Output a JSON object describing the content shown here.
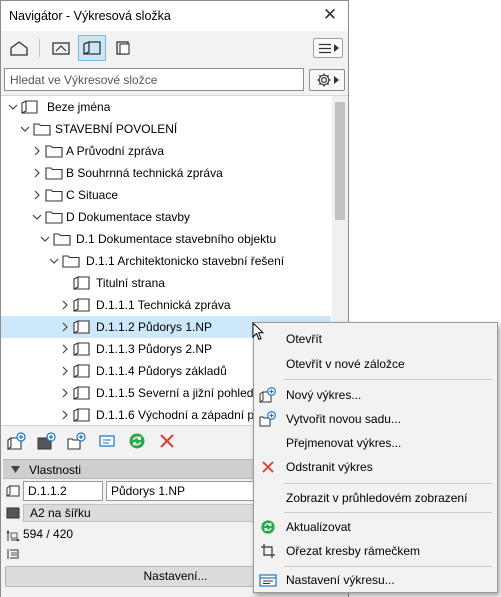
{
  "window": {
    "title": "Navigátor - Výkresová složka"
  },
  "search": {
    "placeholder": "Hledat ve Výkresové složce"
  },
  "toolbar": {
    "buttons": [
      {
        "icon": "project-map-icon"
      },
      {
        "icon": "view-map-icon"
      },
      {
        "icon": "layout-book-icon",
        "active": true
      },
      {
        "icon": "publisher-sets-icon"
      }
    ]
  },
  "tree": {
    "items": [
      {
        "label": "Beze jména",
        "expanded": true
      },
      {
        "label": "STAVEBNÍ POVOLENÍ",
        "expanded": true
      },
      {
        "label": "A Průvodní zpráva",
        "expanded": false
      },
      {
        "label": "B Souhrnná technická zpráva",
        "expanded": false
      },
      {
        "label": "C Situace",
        "expanded": false
      },
      {
        "label": "D Dokumentace stavby",
        "expanded": true
      },
      {
        "label": "D.1 Dokumentace stavebního objektu",
        "expanded": true
      },
      {
        "label": "D.1.1 Architektonicko stavební řešení",
        "expanded": true
      },
      {
        "label": "Titulní strana"
      },
      {
        "label": "D.1.1.1 Technická zpráva",
        "expanded": false
      },
      {
        "label": "D.1.1.2 Půdorys 1.NP",
        "expanded": false,
        "selected": true
      },
      {
        "label": "D.1.1.3 Půdorys 2.NP",
        "expanded": false
      },
      {
        "label": "D.1.1.4 Půdorys základů",
        "expanded": false
      },
      {
        "label": "D.1.1.5 Severní a jižní pohled",
        "expanded": false
      },
      {
        "label": "D.1.1.6 Východní a západní pohled",
        "expanded": false
      }
    ]
  },
  "properties": {
    "header": "Vlastnosti",
    "id_value": "D.1.1.2",
    "name_value": "Půdorys 1.NP",
    "master_layout": "A2 na šířku",
    "size": "594 / 420",
    "settings_button": "Nastavení..."
  },
  "context_menu": {
    "items": [
      {
        "label": "Otevřít",
        "icon": ""
      },
      {
        "label": "Otevřít v nové záložce",
        "icon": ""
      },
      {
        "label": "Nový výkres...",
        "icon": "new-layout-icon"
      },
      {
        "label": "Vytvořit novou sadu...",
        "icon": "new-subset-icon"
      },
      {
        "label": "Přejmenovat výkres...",
        "icon": ""
      },
      {
        "label": "Odstranit výkres",
        "icon": "delete-icon"
      },
      {
        "label": "Zobrazit v průhledovém zobrazení",
        "icon": ""
      },
      {
        "label": "Aktualizovat",
        "icon": "update-icon"
      },
      {
        "label": "Ořezat kresby rámečkem",
        "icon": "crop-icon"
      },
      {
        "label": "Nastavení výkresu...",
        "icon": "layout-settings-icon"
      }
    ]
  },
  "colors": {
    "selection": "#cde8fa",
    "accent_blue": "#1a73c8",
    "delete_red": "#e03a2f",
    "update_green": "#2aa84a"
  }
}
